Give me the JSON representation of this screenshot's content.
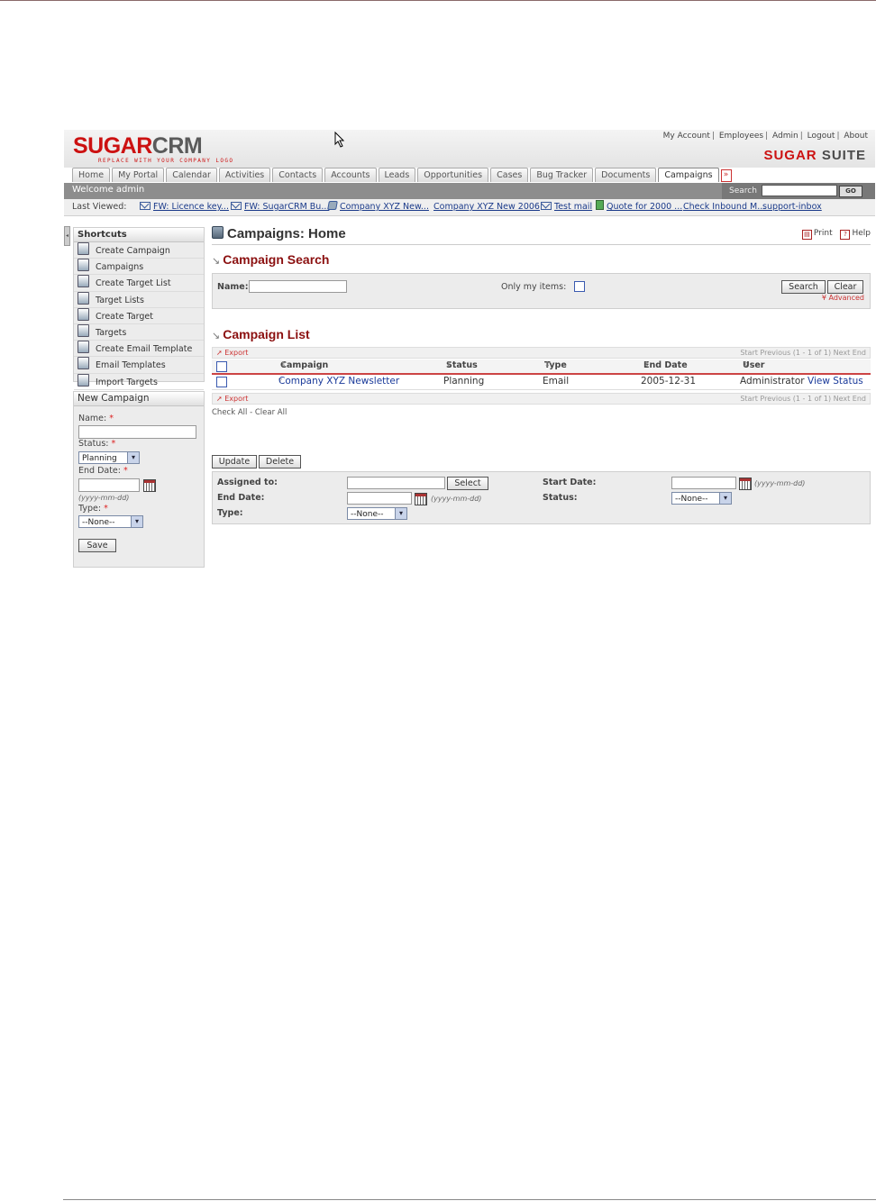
{
  "header": {
    "logo_main_a": "SUGAR",
    "logo_main_b": "CRM",
    "logo_sub": "REPLACE WITH YOUR COMPANY LOGO",
    "suite_a": "SUGAR",
    "suite_b": "SUITE",
    "top_links": [
      "My Account",
      "Employees",
      "Admin",
      "Logout",
      "About"
    ]
  },
  "tabs": [
    "Home",
    "My Portal",
    "Calendar",
    "Activities",
    "Contacts",
    "Accounts",
    "Leads",
    "Opportunities",
    "Cases",
    "Bug Tracker",
    "Documents",
    "Campaigns"
  ],
  "active_tab": "Campaigns",
  "more_tabs_glyph": "»",
  "welcome": "Welcome admin",
  "search": {
    "label": "Search",
    "value": "",
    "go_label": "GO"
  },
  "last_viewed": {
    "label": "Last Viewed:",
    "items": [
      {
        "icon": "envelope-icon",
        "text": "FW: Licence key..."
      },
      {
        "icon": "envelope-icon",
        "text": "FW: SugarCRM Bu..."
      },
      {
        "icon": "campaign-icon",
        "text": "Company XYZ New..."
      },
      {
        "icon": "",
        "text": "Company XYZ New 2006"
      },
      {
        "icon": "envelope-icon",
        "text": "Test mail"
      },
      {
        "icon": "quote-icon",
        "text": "Quote for 2000 ..."
      },
      {
        "icon": "",
        "text": "Check Inbound M..."
      },
      {
        "icon": "",
        "text": "support-inbox"
      }
    ]
  },
  "shortcuts": {
    "title": "Shortcuts",
    "items": [
      "Create Campaign",
      "Campaigns",
      "Create Target List",
      "Target Lists",
      "Create Target",
      "Targets",
      "Create Email Template",
      "Email Templates",
      "Import Targets"
    ]
  },
  "new_campaign": {
    "title": "New Campaign",
    "name_label": "Name:",
    "status_label": "Status:",
    "status_value": "Planning",
    "end_date_label": "End Date:",
    "date_hint": "(yyyy-mm-dd)",
    "type_label": "Type:",
    "type_value": "--None--",
    "save_label": "Save",
    "required_mark": "*"
  },
  "page": {
    "title": "Campaigns: Home",
    "print_label": "Print",
    "help_label": "Help"
  },
  "campaign_search": {
    "title": "Campaign Search",
    "name_label": "Name:",
    "name_value": "",
    "only_my_items_label": "Only my items:",
    "search_label": "Search",
    "clear_label": "Clear",
    "advanced_label": "Advanced"
  },
  "campaign_list": {
    "title": "Campaign List",
    "export_label": "Export",
    "pager": "Start  Previous  (1 - 1 of 1)  Next  End",
    "columns": [
      "Campaign",
      "Status",
      "Type",
      "End Date",
      "User"
    ],
    "rows": [
      {
        "campaign": "Company XYZ Newsletter",
        "status": "Planning",
        "type": "Email",
        "end_date": "2005-12-31",
        "user": "Administrator",
        "action": "View Status"
      }
    ],
    "check_all": "Check All - Clear All"
  },
  "mass_update": {
    "update_label": "Update",
    "delete_label": "Delete",
    "assigned_to_label": "Assigned to:",
    "select_label": "Select",
    "start_date_label": "Start Date:",
    "end_date_label": "End Date:",
    "status_label": "Status:",
    "type_label": "Type:",
    "none_value": "--None--",
    "date_hint": "(yyyy-mm-dd)"
  },
  "colors": {
    "brand_red": "#cc1111",
    "section_title": "#8b1010",
    "link_blue": "#1a3a9a",
    "welcome_bar": "#8d8d8d"
  }
}
